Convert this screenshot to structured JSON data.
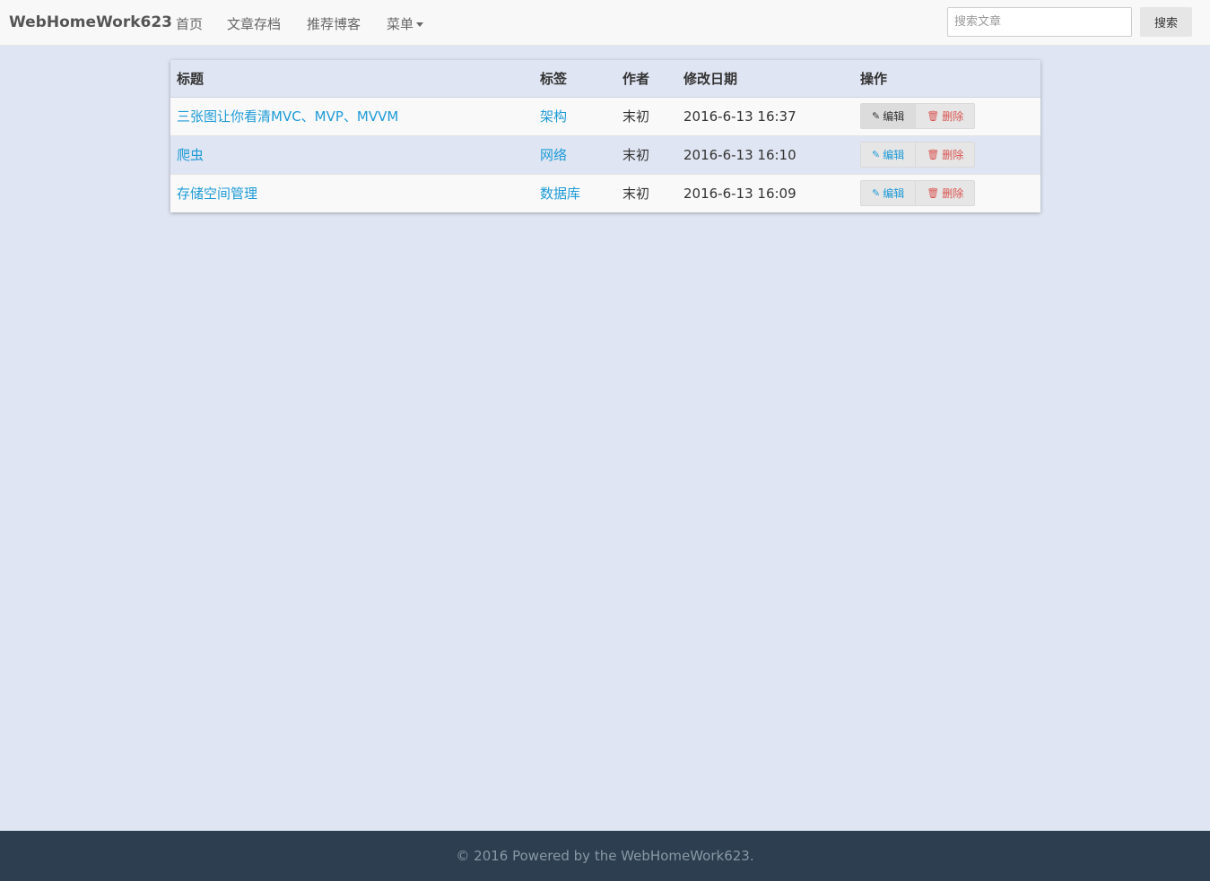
{
  "navbar": {
    "brand": "WebHomeWork623",
    "items": [
      "首页",
      "文章存档",
      "推荐博客"
    ],
    "menu_label": "菜单",
    "search_placeholder": "搜索文章",
    "search_button": "搜索"
  },
  "table": {
    "headers": [
      "标题",
      "标签",
      "作者",
      "修改日期",
      "操作"
    ],
    "rows": [
      {
        "title": "三张图让你看清MVC、MVP、MVVM",
        "tag": "架构",
        "author": "末初",
        "date": "2016-6-13 16:37"
      },
      {
        "title": "爬虫",
        "tag": "网络",
        "author": "末初",
        "date": "2016-6-13 16:10"
      },
      {
        "title": "存储空间管理",
        "tag": "数据库",
        "author": "末初",
        "date": "2016-6-13 16:09"
      }
    ],
    "edit_label": "编辑",
    "delete_label": "删除"
  },
  "footer": {
    "text": "© 2016 Powered by the WebHomeWork623."
  },
  "colors": {
    "link": "#1e9bd7",
    "danger": "#d9534f",
    "footer_bg": "#2c3e50",
    "page_bg": "#dfe5f2"
  }
}
